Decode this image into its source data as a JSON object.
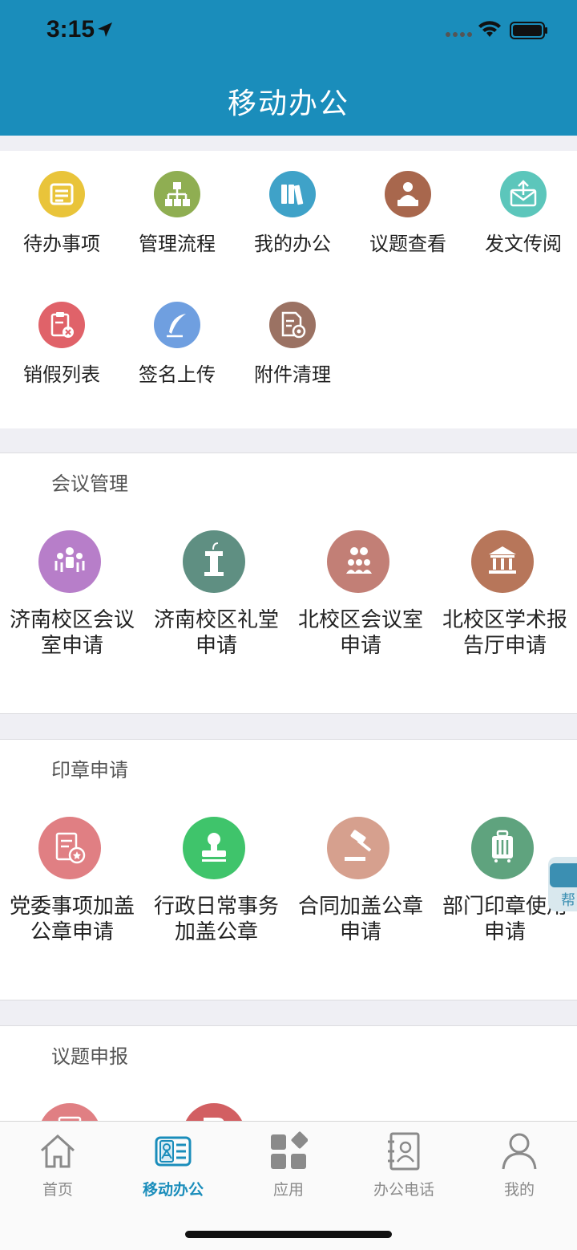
{
  "status_bar": {
    "time": "3:15"
  },
  "header": {
    "title": "移动办公"
  },
  "quick_items": [
    {
      "label": "待办事项",
      "icon": "todo-icon",
      "color": "#e9c43a"
    },
    {
      "label": "管理流程",
      "icon": "flowchart-icon",
      "color": "#8fae52"
    },
    {
      "label": "我的办公",
      "icon": "books-icon",
      "color": "#3fa2c8"
    },
    {
      "label": "议题查看",
      "icon": "speaker-icon",
      "color": "#a8674d"
    },
    {
      "label": "发文传阅",
      "icon": "mail-upload-icon",
      "color": "#5cc6bb"
    },
    {
      "label": "销假列表",
      "icon": "clipboard-cancel-icon",
      "color": "#e06269"
    },
    {
      "label": "签名上传",
      "icon": "feather-icon",
      "color": "#6f9fe0"
    },
    {
      "label": "附件清理",
      "icon": "document-gear-icon",
      "color": "#9b7263"
    }
  ],
  "sections": [
    {
      "title": "会议管理",
      "items": [
        {
          "label": "济南校区会议室申请",
          "icon": "meeting-room-icon",
          "color": "#b77ec9"
        },
        {
          "label": "济南校区礼堂申请",
          "icon": "podium-icon",
          "color": "#5f8f82"
        },
        {
          "label": "北校区会议室申请",
          "icon": "people-group-icon",
          "color": "#c27f76"
        },
        {
          "label": "北校区学术报告厅申请",
          "icon": "hall-building-icon",
          "color": "#b7765a"
        }
      ]
    },
    {
      "title": "印章申请",
      "items": [
        {
          "label": "党委事项加盖公章申请",
          "icon": "seal-document-icon",
          "color": "#e07f83"
        },
        {
          "label": "行政日常事务加盖公章",
          "icon": "stamp-icon",
          "color": "#3fc46b"
        },
        {
          "label": "合同加盖公章申请",
          "icon": "gavel-icon",
          "color": "#d6a08e"
        },
        {
          "label": "部门印章使用申请",
          "icon": "luggage-icon",
          "color": "#5fa37e"
        }
      ]
    },
    {
      "title": "议题申报",
      "items": [
        {
          "label": "",
          "icon": "document-icon",
          "color": "#e07f83"
        },
        {
          "label": "",
          "icon": "chat-icon",
          "color": "#d25f62"
        }
      ]
    }
  ],
  "help_button": {
    "label": "帮"
  },
  "tabs": [
    {
      "label": "首页",
      "icon": "home-icon"
    },
    {
      "label": "移动办公",
      "icon": "contact-card-icon"
    },
    {
      "label": "应用",
      "icon": "apps-grid-icon"
    },
    {
      "label": "办公电话",
      "icon": "address-book-icon"
    },
    {
      "label": "我的",
      "icon": "person-icon"
    }
  ],
  "colors": {
    "header": "#1a8dbb",
    "tab_active": "#1a8dbb",
    "tab_inactive": "#8a8a8a"
  }
}
